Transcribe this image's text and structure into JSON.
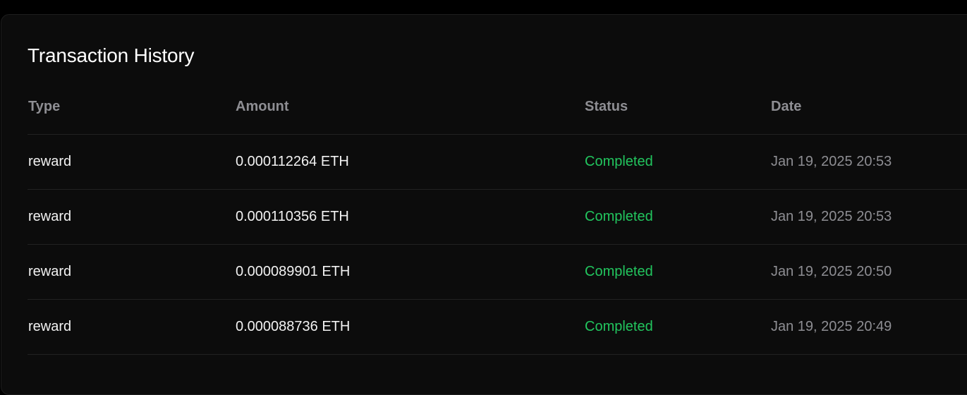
{
  "panel": {
    "title": "Transaction History"
  },
  "table": {
    "columns": [
      "Type",
      "Amount",
      "Status",
      "Date"
    ],
    "rows": [
      {
        "type": "reward",
        "amount": "0.000112264 ETH",
        "status": "Completed",
        "date": "Jan 19, 2025 20:53"
      },
      {
        "type": "reward",
        "amount": "0.000110356 ETH",
        "status": "Completed",
        "date": "Jan 19, 2025 20:53"
      },
      {
        "type": "reward",
        "amount": "0.000089901 ETH",
        "status": "Completed",
        "date": "Jan 19, 2025 20:50"
      },
      {
        "type": "reward",
        "amount": "0.000088736 ETH",
        "status": "Completed",
        "date": "Jan 19, 2025 20:49"
      }
    ]
  },
  "colors": {
    "background": "#000000",
    "card": "#0c0c0c",
    "status_completed": "#22c55e",
    "muted_text": "#8e8e93",
    "divider": "#222222"
  }
}
